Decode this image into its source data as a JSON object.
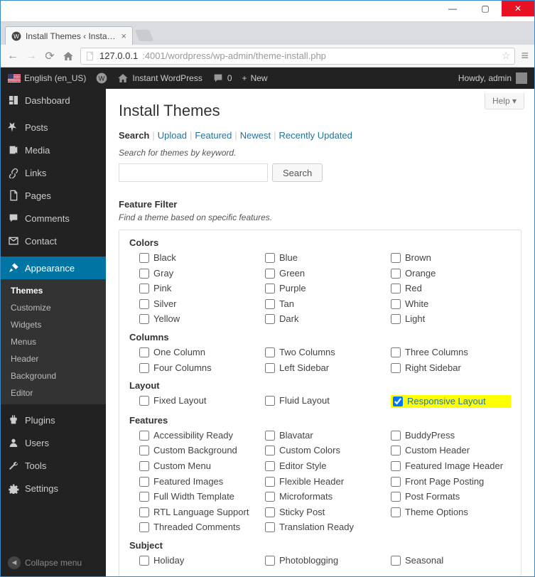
{
  "window": {
    "tab_title": "Install Themes ‹ Instant W",
    "url_host": "127.0.0.1",
    "url_rest": ":4001/wordpress/wp-admin/theme-install.php"
  },
  "adminbar": {
    "lang": "English (en_US)",
    "site": "Instant WordPress",
    "comments": "0",
    "new": "New",
    "howdy": "Howdy, admin"
  },
  "sidebar": {
    "items": [
      {
        "key": "dashboard",
        "label": "Dashboard",
        "icon": "dashboard"
      },
      {
        "key": "posts",
        "label": "Posts",
        "icon": "pin"
      },
      {
        "key": "media",
        "label": "Media",
        "icon": "media"
      },
      {
        "key": "links",
        "label": "Links",
        "icon": "link"
      },
      {
        "key": "pages",
        "label": "Pages",
        "icon": "page"
      },
      {
        "key": "comments",
        "label": "Comments",
        "icon": "comment"
      },
      {
        "key": "contact",
        "label": "Contact",
        "icon": "contact"
      },
      {
        "key": "appearance",
        "label": "Appearance",
        "icon": "brush",
        "current": true
      },
      {
        "key": "plugins",
        "label": "Plugins",
        "icon": "plugin"
      },
      {
        "key": "users",
        "label": "Users",
        "icon": "user"
      },
      {
        "key": "tools",
        "label": "Tools",
        "icon": "wrench"
      },
      {
        "key": "settings",
        "label": "Settings",
        "icon": "settings"
      }
    ],
    "submenu": [
      "Themes",
      "Customize",
      "Widgets",
      "Menus",
      "Header",
      "Background",
      "Editor"
    ],
    "submenu_active": "Themes",
    "collapse": "Collapse menu"
  },
  "content": {
    "help": "Help ▾",
    "title": "Install Themes",
    "filters": [
      "Search",
      "Upload",
      "Featured",
      "Newest",
      "Recently Updated"
    ],
    "filters_current": "Search",
    "search_help": "Search for themes by keyword.",
    "search_button": "Search",
    "ff_head": "Feature Filter",
    "ff_sub": "Find a theme based on specific features.",
    "categories": [
      {
        "name": "Colors",
        "items": [
          "Black",
          "Blue",
          "Brown",
          "Gray",
          "Green",
          "Orange",
          "Pink",
          "Purple",
          "Red",
          "Silver",
          "Tan",
          "White",
          "Yellow",
          "Dark",
          "Light"
        ]
      },
      {
        "name": "Columns",
        "items": [
          "One Column",
          "Two Columns",
          "Three Columns",
          "Four Columns",
          "Left Sidebar",
          "Right Sidebar"
        ]
      },
      {
        "name": "Layout",
        "items": [
          "Fixed Layout",
          "Fluid Layout",
          "Responsive Layout"
        ],
        "checked": "Responsive Layout",
        "highlight": "Responsive Layout"
      },
      {
        "name": "Features",
        "items": [
          "Accessibility Ready",
          "Blavatar",
          "BuddyPress",
          "Custom Background",
          "Custom Colors",
          "Custom Header",
          "Custom Menu",
          "Editor Style",
          "Featured Image Header",
          "Featured Images",
          "Flexible Header",
          "Front Page Posting",
          "Full Width Template",
          "Microformats",
          "Post Formats",
          "RTL Language Support",
          "Sticky Post",
          "Theme Options",
          "Threaded Comments",
          "Translation Ready"
        ]
      },
      {
        "name": "Subject",
        "items": [
          "Holiday",
          "Photoblogging",
          "Seasonal"
        ]
      }
    ]
  }
}
